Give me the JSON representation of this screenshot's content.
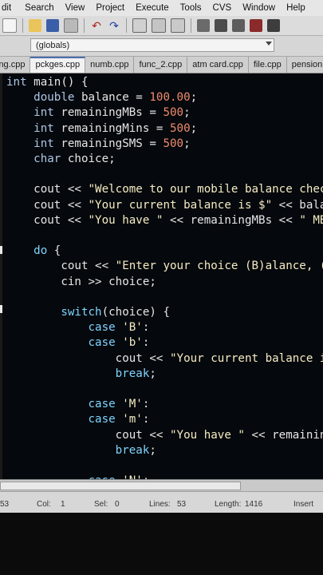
{
  "menu": [
    "dit",
    "Search",
    "View",
    "Project",
    "Execute",
    "Tools",
    "CVS",
    "Window",
    "Help"
  ],
  "scope": {
    "value": "(globals)"
  },
  "tabs": [
    "ing.cpp",
    "pckges.cpp",
    "numb.cpp",
    "func_2.cpp",
    "atm card.cpp",
    "file.cpp",
    "pension.cpp"
  ],
  "active_tab": 1,
  "code_lines": [
    [
      [
        "int ",
        "kw"
      ],
      [
        "main() {",
        ""
      ]
    ],
    [
      [
        "    double ",
        "kw"
      ],
      [
        "balance = ",
        ""
      ],
      [
        "100.00",
        "num"
      ],
      [
        ";",
        ""
      ]
    ],
    [
      [
        "    int ",
        "kw"
      ],
      [
        "remainingMBs = ",
        ""
      ],
      [
        "500",
        "num"
      ],
      [
        ";",
        ""
      ]
    ],
    [
      [
        "    int ",
        "kw"
      ],
      [
        "remainingMins = ",
        ""
      ],
      [
        "500",
        "num"
      ],
      [
        ";",
        ""
      ]
    ],
    [
      [
        "    int ",
        "kw"
      ],
      [
        "remainingSMS = ",
        ""
      ],
      [
        "500",
        "num"
      ],
      [
        ";",
        ""
      ]
    ],
    [
      [
        "    char ",
        "kw"
      ],
      [
        "choice;",
        ""
      ]
    ],
    [
      [
        "",
        ""
      ]
    ],
    [
      [
        "    cout << ",
        ""
      ],
      [
        "\"Welcome to our mobile balance chec",
        "str"
      ]
    ],
    [
      [
        "    cout << ",
        ""
      ],
      [
        "\"Your current balance is $\"",
        "str"
      ],
      [
        " << bala",
        ""
      ]
    ],
    [
      [
        "    cout << ",
        ""
      ],
      [
        "\"You have \"",
        "str"
      ],
      [
        " << remainingMBs << ",
        ""
      ],
      [
        "\" MB",
        "str"
      ]
    ],
    [
      [
        "",
        ""
      ]
    ],
    [
      [
        "    do ",
        "ctl"
      ],
      [
        "{",
        ""
      ]
    ],
    [
      [
        "        cout << ",
        ""
      ],
      [
        "\"Enter your choice (B)alance, (M)",
        "str"
      ]
    ],
    [
      [
        "        cin >> choice;",
        ""
      ]
    ],
    [
      [
        "",
        ""
      ]
    ],
    [
      [
        "        switch",
        "ctl"
      ],
      [
        "(choice) {",
        ""
      ]
    ],
    [
      [
        "            case ",
        "ctl"
      ],
      [
        "'B'",
        "str"
      ],
      [
        ":",
        ""
      ]
    ],
    [
      [
        "            case ",
        "ctl"
      ],
      [
        "'b'",
        "str"
      ],
      [
        ":",
        ""
      ]
    ],
    [
      [
        "                cout << ",
        ""
      ],
      [
        "\"Your current balance is $\"",
        "str"
      ]
    ],
    [
      [
        "                break",
        "ctl"
      ],
      [
        ";",
        ""
      ]
    ],
    [
      [
        "",
        ""
      ]
    ],
    [
      [
        "            case ",
        "ctl"
      ],
      [
        "'M'",
        "str"
      ],
      [
        ":",
        ""
      ]
    ],
    [
      [
        "            case ",
        "ctl"
      ],
      [
        "'m'",
        "str"
      ],
      [
        ":",
        ""
      ]
    ],
    [
      [
        "                cout << ",
        ""
      ],
      [
        "\"You have \"",
        "str"
      ],
      [
        " << remainingMBs",
        ""
      ]
    ],
    [
      [
        "                break",
        "ctl"
      ],
      [
        ";",
        ""
      ]
    ],
    [
      [
        "",
        ""
      ]
    ],
    [
      [
        "            case ",
        "ctl"
      ],
      [
        "'N'",
        "str"
      ],
      [
        ":",
        ""
      ]
    ]
  ],
  "status": {
    "line": "53",
    "col_label": "Col:",
    "col_value": "1",
    "sel_label": "Sel:",
    "sel_value": "0",
    "lines_label": "Lines:",
    "lines_value": "53",
    "length_label": "Length:",
    "length_value": "1416",
    "mode": "Insert"
  },
  "colors": {
    "editor_bg": "#05080c",
    "keyword": "#aec7e8",
    "number": "#f08c6c",
    "string": "#f6ecc4",
    "control": "#7fd4ff"
  },
  "toolbar_icons": [
    "new-file-icon",
    "open-icon",
    "save-icon",
    "print-icon",
    "undo-icon",
    "redo-icon",
    "find-icon",
    "replace-icon",
    "goto-icon",
    "compile-icon",
    "run-icon",
    "debug-icon",
    "stop-icon"
  ]
}
